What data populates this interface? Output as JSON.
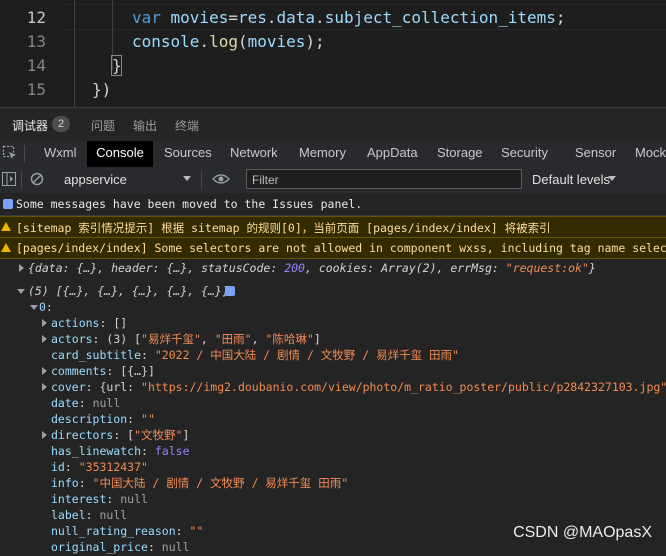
{
  "editor": {
    "lines": [
      {
        "num": "12",
        "parts": [
          {
            "t": "var ",
            "c": "kw"
          },
          {
            "t": "movies",
            "c": "var"
          },
          {
            "t": "=",
            "c": "punc"
          },
          {
            "t": "res",
            "c": "var"
          },
          {
            "t": ".",
            "c": "punc"
          },
          {
            "t": "data",
            "c": "var"
          },
          {
            "t": ".",
            "c": "punc"
          },
          {
            "t": "subject_collection_items",
            "c": "var"
          },
          {
            "t": ";",
            "c": "punc"
          }
        ]
      },
      {
        "num": "13",
        "parts": [
          {
            "t": "console",
            "c": "var"
          },
          {
            "t": ".",
            "c": "punc"
          },
          {
            "t": "log",
            "c": "fn"
          },
          {
            "t": "(",
            "c": "punc"
          },
          {
            "t": "movies",
            "c": "var"
          },
          {
            "t": ");",
            "c": "punc"
          }
        ]
      },
      {
        "num": "14",
        "parts": [
          {
            "t": "}",
            "c": "punc"
          }
        ]
      },
      {
        "num": "15",
        "parts": [
          {
            "t": "})",
            "c": "punc"
          }
        ]
      }
    ]
  },
  "panel_tabs": {
    "debugger": "调试器",
    "debugger_count": "2",
    "issues": "问题",
    "output": "输出",
    "terminal": "终端"
  },
  "devtools_tabs": [
    "Wxml",
    "Console",
    "Sources",
    "Network",
    "Memory",
    "AppData",
    "Storage",
    "Security",
    "Sensor",
    "Mock"
  ],
  "toolbar": {
    "context": "appservice",
    "filter_placeholder": "Filter",
    "levels": "Default levels"
  },
  "console": {
    "info_msg": "Some messages have been moved to the Issues panel.",
    "warn1": "[sitemap 索引情况提示] 根据 sitemap 的规则[0]，当前页面 [pages/index/index] 将被索引",
    "warn2": "[pages/index/index] Some selectors are not allowed in component wxss, including tag name selectors,",
    "response_prefix": "{data: {…}, header: {…}, statusCode: ",
    "response_status": "200",
    "response_mid": ", cookies: Array(2), errMsg: ",
    "response_errmsg": "\"request:ok\"",
    "response_suffix": "}",
    "array_summary": "(5) [{…}, {…}, {…}, {…}, {…}]",
    "index0": "0:",
    "props": [
      {
        "key": "actions",
        "value": "[]",
        "expandable": true,
        "vt": "plain"
      },
      {
        "key": "actors",
        "value": "(3) [\"易烊千玺\", \"田雨\", \"陈哈琳\"]",
        "expandable": true,
        "vt": "mixed"
      },
      {
        "key": "card_subtitle",
        "value": "\"2022 / 中国大陆 / 剧情 / 文牧野 / 易烊千玺 田雨\"",
        "expandable": false,
        "vt": "str"
      },
      {
        "key": "comments",
        "value": "[{…}]",
        "expandable": true,
        "vt": "plain"
      },
      {
        "key": "cover",
        "value": "{url: \"https://img2.doubanio.com/view/photo/m_ratio_poster/public/p2842327103.jpg\", wi",
        "expandable": true,
        "vt": "mixedurl"
      },
      {
        "key": "date",
        "value": "null",
        "expandable": false,
        "vt": "null"
      },
      {
        "key": "description",
        "value": "\"\"",
        "expandable": false,
        "vt": "str"
      },
      {
        "key": "directors",
        "value": "[\"文牧野\"]",
        "expandable": true,
        "vt": "mixed"
      },
      {
        "key": "has_linewatch",
        "value": "false",
        "expandable": false,
        "vt": "kwd"
      },
      {
        "key": "id",
        "value": "\"35312437\"",
        "expandable": false,
        "vt": "str"
      },
      {
        "key": "info",
        "value": "\"中国大陆 / 剧情 / 文牧野 / 易烊千玺 田雨\"",
        "expandable": false,
        "vt": "str"
      },
      {
        "key": "interest",
        "value": "null",
        "expandable": false,
        "vt": "null"
      },
      {
        "key": "label",
        "value": "null",
        "expandable": false,
        "vt": "null"
      },
      {
        "key": "null_rating_reason",
        "value": "\"\"",
        "expandable": false,
        "vt": "str"
      },
      {
        "key": "original_price",
        "value": "null",
        "expandable": false,
        "vt": "null"
      }
    ]
  },
  "watermark": "CSDN @MAOpasX"
}
